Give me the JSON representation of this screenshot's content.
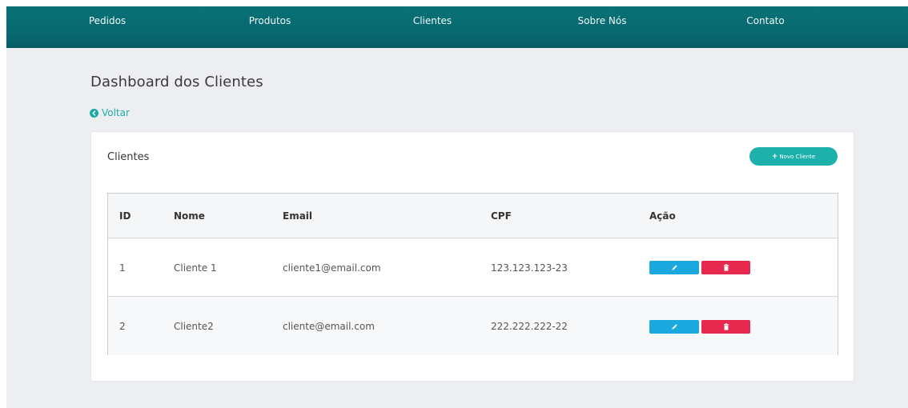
{
  "nav": {
    "items": [
      "Pedidos",
      "Produtos",
      "Clientes",
      "Sobre Nós",
      "Contato"
    ]
  },
  "page": {
    "title": "Dashboard dos Clientes",
    "back_label": "Voltar"
  },
  "card": {
    "title": "Clientes",
    "new_button_label": "Novo Cliente"
  },
  "table": {
    "headers": [
      "ID",
      "Nome",
      "Email",
      "CPF",
      "Ação"
    ],
    "rows": [
      {
        "id": "1",
        "nome": "Cliente 1",
        "email": "cliente1@email.com",
        "cpf": "123.123.123-23"
      },
      {
        "id": "2",
        "nome": "Cliente2",
        "email": "cliente@email.com",
        "cpf": "222.222.222-22"
      }
    ]
  },
  "colors": {
    "navbar": "#07676e",
    "accent": "#1eb1ac",
    "edit": "#1ba8df",
    "delete": "#e8294f",
    "background": "#eceef1"
  },
  "icons": {
    "back": "arrow-circle-left-icon",
    "new": "plus-icon",
    "edit": "pencil-icon",
    "delete": "trash-icon"
  }
}
